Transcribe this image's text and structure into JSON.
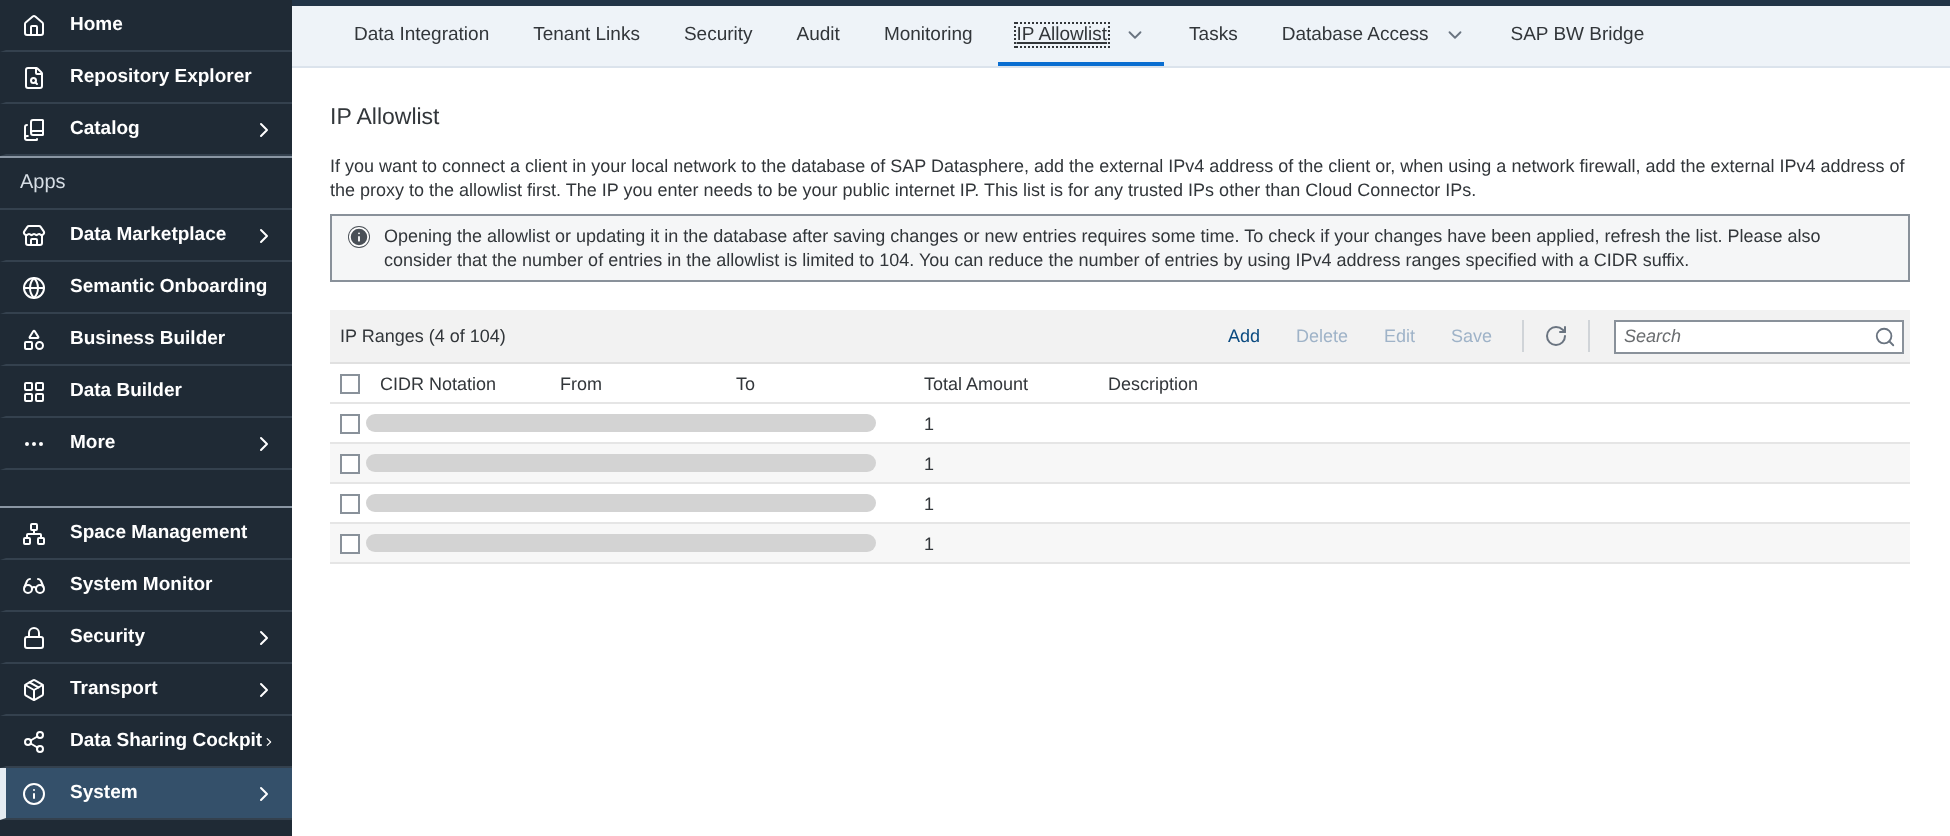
{
  "sidebar": {
    "groups": [
      {
        "items": [
          {
            "label": "Home",
            "has_submenu": false,
            "selected": false
          },
          {
            "label": "Repository Explorer",
            "has_submenu": false,
            "selected": false
          },
          {
            "label": "Catalog",
            "has_submenu": true,
            "selected": false
          }
        ]
      },
      {
        "header": "Apps",
        "items": [
          {
            "label": "Data Marketplace",
            "has_submenu": true,
            "selected": false
          },
          {
            "label": "Semantic Onboarding",
            "has_submenu": false,
            "selected": false
          },
          {
            "label": "Business Builder",
            "has_submenu": false,
            "selected": false
          },
          {
            "label": "Data Builder",
            "has_submenu": false,
            "selected": false
          },
          {
            "label": "More",
            "has_submenu": true,
            "selected": false
          }
        ]
      },
      {
        "items": [
          {
            "label": "Space Management",
            "has_submenu": false,
            "selected": false
          },
          {
            "label": "System Monitor",
            "has_submenu": false,
            "selected": false
          },
          {
            "label": "Security",
            "has_submenu": true,
            "selected": false
          },
          {
            "label": "Transport",
            "has_submenu": true,
            "selected": false
          },
          {
            "label": "Data Sharing Cockpit",
            "has_submenu": true,
            "selected": false
          },
          {
            "label": "System",
            "has_submenu": true,
            "selected": true
          }
        ]
      }
    ]
  },
  "tabs": [
    {
      "label": "Data Integration",
      "selected": false,
      "has_dropdown": false
    },
    {
      "label": "Tenant Links",
      "selected": false,
      "has_dropdown": false
    },
    {
      "label": "Security",
      "selected": false,
      "has_dropdown": false
    },
    {
      "label": "Audit",
      "selected": false,
      "has_dropdown": false
    },
    {
      "label": "Monitoring",
      "selected": false,
      "has_dropdown": false
    },
    {
      "label": "IP Allowlist",
      "selected": true,
      "has_dropdown": true
    },
    {
      "label": "Tasks",
      "selected": false,
      "has_dropdown": false
    },
    {
      "label": "Database Access",
      "selected": false,
      "has_dropdown": true
    },
    {
      "label": "SAP BW Bridge",
      "selected": false,
      "has_dropdown": false
    }
  ],
  "page": {
    "title": "IP Allowlist",
    "description": "If you want to connect a client in your local network to the database of SAP Datasphere, add the external IPv4 address of the client or, when using a network firewall, add the external IPv4 address of the proxy to the allowlist first. The IP you enter needs to be your public internet IP. This list is for any trusted IPs other than Cloud Connector IPs.",
    "info": "Opening the allowlist or updating it in the database after saving changes or new entries requires some time. To check if your changes have been applied, refresh the list. Please also consider that the number of entries in the allowlist is limited to 104. You can reduce the number of entries by using IPv4 address ranges specified with a CIDR suffix."
  },
  "table": {
    "title": "IP Ranges (4 of 104)",
    "actions": [
      {
        "label": "Add",
        "disabled": false
      },
      {
        "label": "Delete",
        "disabled": true
      },
      {
        "label": "Edit",
        "disabled": true
      },
      {
        "label": "Save",
        "disabled": true
      }
    ],
    "search": {
      "placeholder": "Search"
    },
    "select_all_checked": false,
    "columns": [
      "CIDR Notation",
      "From",
      "To",
      "Total Amount",
      "Description"
    ],
    "rows": [
      {
        "checked": false,
        "total_amount": "1"
      },
      {
        "checked": false,
        "total_amount": "1"
      },
      {
        "checked": false,
        "total_amount": "1"
      },
      {
        "checked": false,
        "total_amount": "1"
      }
    ]
  }
}
